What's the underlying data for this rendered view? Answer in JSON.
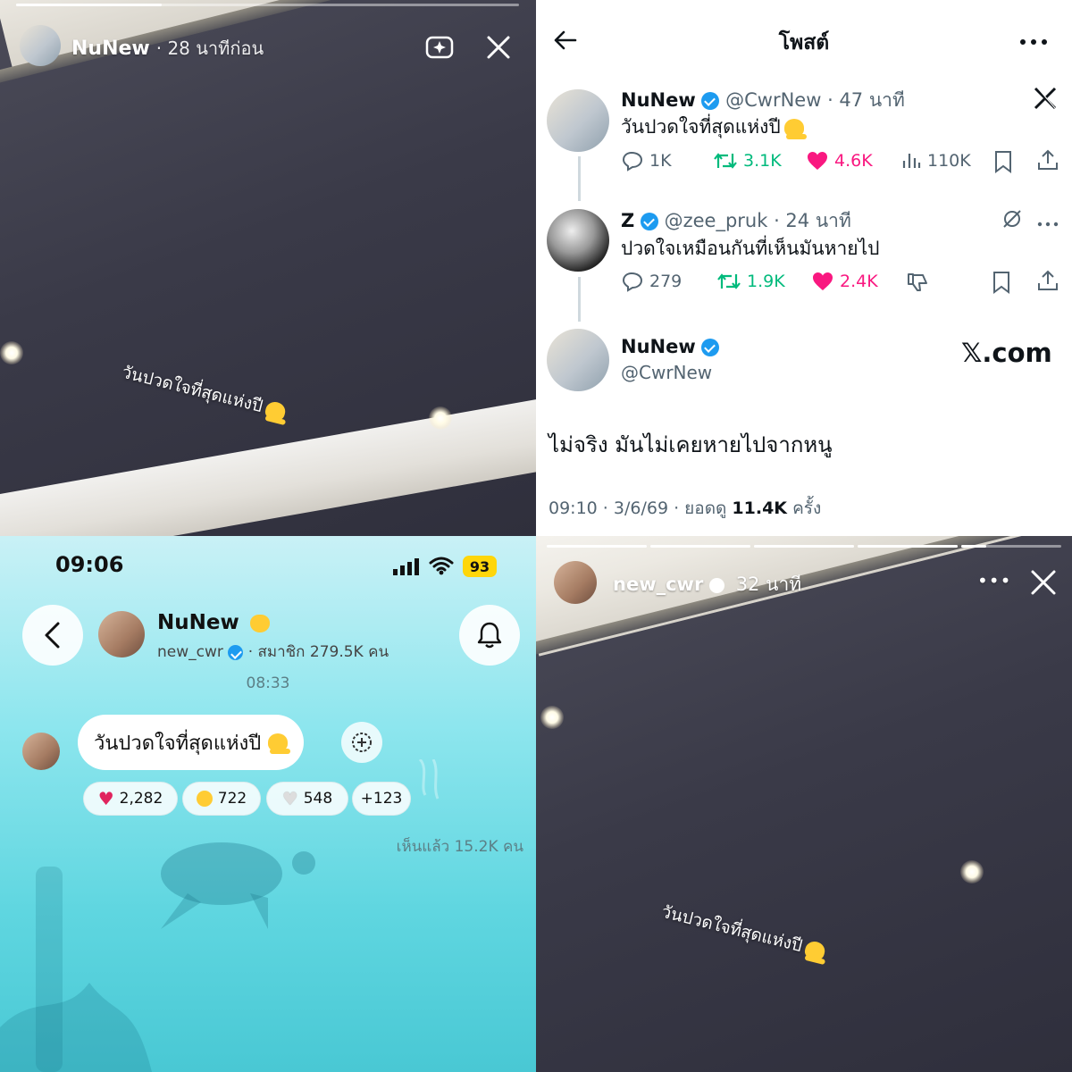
{
  "q1": {
    "username": "NuNew",
    "time": "· 28 นาทีก่อน",
    "caption": "วันปวดใจที่สุดแห่งปี",
    "caption_emoji": "melting-face",
    "progress": 0.29
  },
  "q2": {
    "header_title": "โพสต์",
    "tweet1": {
      "name": "NuNew",
      "handle_time": "@CwrNew · 47 นาที",
      "text": "วันปวดใจที่สุดแห่งปี",
      "replies": "1K",
      "retweets": "3.1K",
      "likes": "4.6K",
      "views": "110K"
    },
    "tweet2": {
      "name": "Z",
      "handle_time": "@zee_pruk · 24 นาที",
      "text": "ปวดใจเหมือนกันที่เห็นมันหายไป",
      "replies": "279",
      "retweets": "1.9K",
      "likes": "2.4K"
    },
    "tweet3": {
      "name": "NuNew",
      "handle": "@CwrNew",
      "watermark": "𝕏.com",
      "text": "ไม่จริง มันไม่เคยหายไปจากหนู",
      "meta_prefix": "09:10 · 3/6/69 · ยอดดู ",
      "meta_views": "11.4K",
      "meta_suffix": " ครั้ง"
    },
    "colors": {
      "like": "#f91880",
      "retweet": "#00ba7c",
      "verified": "#1d9bf0"
    }
  },
  "q3": {
    "status_time": "09:06",
    "battery": "93",
    "channel_name": "NuNew",
    "channel_emoji": "cat-face",
    "channel_sub": "new_cwr",
    "members": "· สมาชิก 279.5K คน",
    "timestamp": "08:33",
    "message": "วันปวดใจที่สุดแห่งปี",
    "reactions": [
      {
        "emoji": "red-heart",
        "count": "2,282"
      },
      {
        "emoji": "astonished-face",
        "count": "722"
      },
      {
        "emoji": "white-heart",
        "count": "548"
      },
      {
        "emoji": "",
        "count": "+123"
      }
    ],
    "seen": "เห็นแล้ว 15.2K คน"
  },
  "q4": {
    "username": "new_cwr",
    "time": "32 นาที",
    "caption": "วันปวดใจที่สุดแห่งปี",
    "caption_emoji": "melting-face",
    "more": "•••"
  }
}
